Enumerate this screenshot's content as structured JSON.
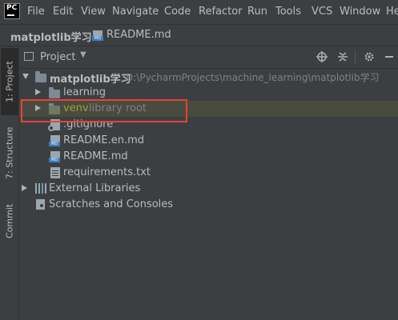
{
  "menubar": {
    "items": [
      "File",
      "Edit",
      "View",
      "Navigate",
      "Code",
      "Refactor",
      "Run",
      "Tools",
      "VCS",
      "Window",
      "He"
    ]
  },
  "breadcrumb": {
    "project": "matplotlib学习",
    "file": "README.md"
  },
  "left_tabs": {
    "project": "1: Project",
    "structure": "7: Structure",
    "commit": "Commit"
  },
  "panel": {
    "title": "Project"
  },
  "tree": {
    "root_name": "matplotlib学习",
    "root_path": "D:\\PycharmProjects\\machine_learning\\matplotlib学习",
    "items": [
      {
        "label": "learning"
      },
      {
        "label": "venv",
        "suffix": "library root"
      },
      {
        "label": ".gitignore"
      },
      {
        "label": "README.en.md"
      },
      {
        "label": "README.md"
      },
      {
        "label": "requirements.txt"
      }
    ],
    "external": "External Libraries",
    "scratches": "Scratches and Consoles"
  },
  "colors": {
    "background": "#3c3f41",
    "venv_text": "#a0a03c",
    "highlight_box": "#e8413a"
  }
}
